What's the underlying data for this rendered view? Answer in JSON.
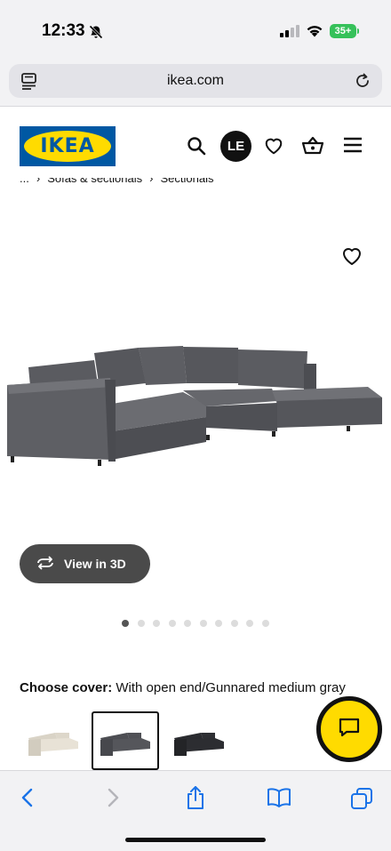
{
  "status_bar": {
    "time": "12:33",
    "battery": "35+"
  },
  "browser": {
    "url": "ikea.com"
  },
  "header": {
    "logo_text": "IKEA",
    "avatar_initials": "LE",
    "brand_blue": "#0058a3",
    "brand_yellow": "#ffdb00"
  },
  "breadcrumb": {
    "items": [
      "...",
      "Sofas & sectionals",
      "Sectionals"
    ]
  },
  "product": {
    "view_3d_label": "View in 3D",
    "image_count": 10,
    "active_image_index": 0
  },
  "cover": {
    "label": "Choose cover:",
    "value": "With open end/Gunnared medium gray",
    "swatches": [
      {
        "name": "beige",
        "color": "#e8e2d6",
        "selected": false
      },
      {
        "name": "medium-gray",
        "color": "#55565b",
        "selected": true
      },
      {
        "name": "dark-gray",
        "color": "#2c2d31",
        "selected": false
      }
    ]
  },
  "icons": {
    "header": [
      "search-icon",
      "heart-icon",
      "basket-icon",
      "menu-icon"
    ],
    "toolbar": [
      "back-icon",
      "forward-icon",
      "share-icon",
      "bookmarks-icon",
      "tabs-icon"
    ]
  }
}
